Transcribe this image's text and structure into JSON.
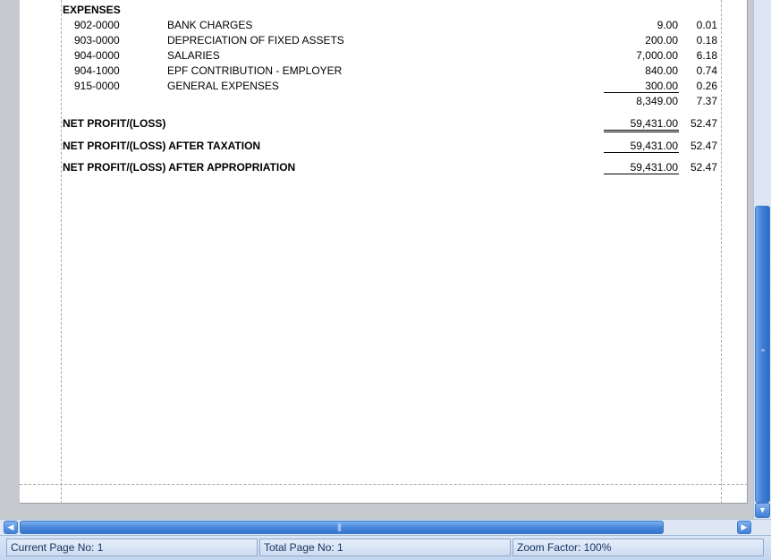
{
  "report": {
    "section_title": "EXPENSES",
    "expenses": [
      {
        "code": "902-0000",
        "name": "BANK CHARGES",
        "amount": "9.00",
        "percent": "0.01"
      },
      {
        "code": "903-0000",
        "name": "DEPRECIATION OF FIXED ASSETS",
        "amount": "200.00",
        "percent": "0.18"
      },
      {
        "code": "904-0000",
        "name": "SALARIES",
        "amount": "7,000.00",
        "percent": "6.18"
      },
      {
        "code": "904-1000",
        "name": "EPF CONTRIBUTION - EMPLOYER",
        "amount": "840.00",
        "percent": "0.74"
      },
      {
        "code": "915-0000",
        "name": "GENERAL EXPENSES",
        "amount": "300.00",
        "percent": "0.26"
      }
    ],
    "expenses_total": {
      "amount": "8,349.00",
      "percent": "7.37"
    },
    "summary": [
      {
        "label": "NET PROFIT/(LOSS)",
        "amount": "59,431.00",
        "percent": "52.47"
      },
      {
        "label": "NET PROFIT/(LOSS) AFTER TAXATION",
        "amount": "59,431.00",
        "percent": "52.47"
      },
      {
        "label": "NET PROFIT/(LOSS) AFTER APPROPRIATION",
        "amount": "59,431.00",
        "percent": "52.47"
      }
    ]
  },
  "status_bar": {
    "current_page": "Current Page No: 1",
    "total_page": "Total Page No: 1",
    "zoom_factor": "Zoom Factor: 100%"
  },
  "icons": {
    "scroll_up": "scroll-down-arrow-icon",
    "scroll_left": "scroll-left-arrow-icon",
    "scroll_right": "scroll-right-arrow-icon"
  },
  "colors": {
    "scroll_thumb": "#3f7fd6",
    "status_text": "#15325e"
  }
}
